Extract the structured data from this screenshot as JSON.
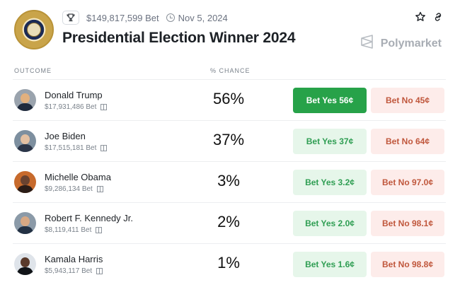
{
  "market": {
    "volume": "$149,817,599 Bet",
    "date": "Nov 5, 2024",
    "title": "Presidential Election Winner 2024",
    "brand": "Polymarket",
    "icons": [
      "trophy-icon",
      "clock-icon",
      "star-icon",
      "link-icon",
      "polymarket-logo-icon"
    ]
  },
  "columns": {
    "outcome": "OUTCOME",
    "chance": "% CHANCE"
  },
  "colors": {
    "yes_active": "#27a249",
    "yes_bg": "#e6f6ea",
    "yes_text": "#2f9e53",
    "no_bg": "#fdecea",
    "no_text": "#c0573c"
  },
  "outcomes": [
    {
      "name": "Donald Trump",
      "bet": "$17,931,486 Bet",
      "chance": "56%",
      "yes": "Bet Yes 56¢",
      "no": "Bet No 45¢"
    },
    {
      "name": "Joe Biden",
      "bet": "$17,515,181 Bet",
      "chance": "37%",
      "yes": "Bet Yes 37¢",
      "no": "Bet No 64¢"
    },
    {
      "name": "Michelle Obama",
      "bet": "$9,286,134 Bet",
      "chance": "3%",
      "yes": "Bet Yes 3.2¢",
      "no": "Bet No 97.0¢"
    },
    {
      "name": "Robert F. Kennedy Jr.",
      "bet": "$8,119,411 Bet",
      "chance": "2%",
      "yes": "Bet Yes 2.0¢",
      "no": "Bet No 98.1¢"
    },
    {
      "name": "Kamala Harris",
      "bet": "$5,943,117 Bet",
      "chance": "1%",
      "yes": "Bet Yes 1.6¢",
      "no": "Bet No 98.8¢"
    }
  ]
}
